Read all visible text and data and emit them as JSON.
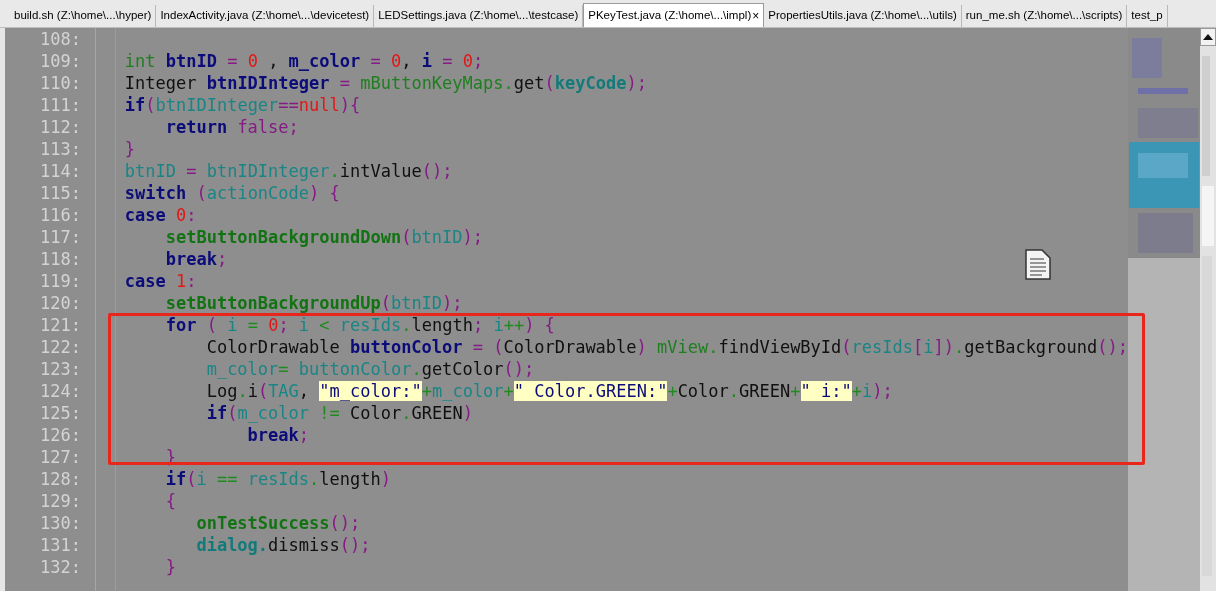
{
  "tabs": [
    {
      "label": "build.sh (Z:\\home\\...\\hyper)",
      "selected": false
    },
    {
      "label": "IndexActivity.java (Z:\\home\\...\\devicetest)",
      "selected": false
    },
    {
      "label": "LEDSettings.java (Z:\\home\\...\\testcase)",
      "selected": false
    },
    {
      "label": "PKeyTest.java (Z:\\home\\...\\impl)",
      "selected": true,
      "close": "×"
    },
    {
      "label": "PropertiesUtils.java (Z:\\home\\...\\utils)",
      "selected": false
    },
    {
      "label": "run_me.sh (Z:\\home\\...\\scripts)",
      "selected": false
    },
    {
      "label": "test_p",
      "selected": false
    }
  ],
  "editor": {
    "lines": [
      {
        "number": "108:"
      },
      {
        "number": "109:",
        "tokens": [
          {
            "kind": "type",
            "text": "int "
          },
          {
            "kind": "keyword",
            "text": "btnID"
          },
          {
            "kind": "bracket",
            "text": " = "
          },
          {
            "kind": "number",
            "text": "0"
          },
          {
            "kind": "plain",
            "text": " , "
          },
          {
            "kind": "keyword",
            "text": "m_color"
          },
          {
            "kind": "bracket",
            "text": " = "
          },
          {
            "kind": "number",
            "text": "0"
          },
          {
            "kind": "plain",
            "text": ", "
          },
          {
            "kind": "keyword",
            "text": "i"
          },
          {
            "kind": "bracket",
            "text": " = "
          },
          {
            "kind": "number",
            "text": "0"
          },
          {
            "kind": "bracket",
            "text": ";"
          }
        ]
      },
      {
        "number": "110:",
        "tokens": [
          {
            "kind": "plain",
            "text": "Integer "
          },
          {
            "kind": "keyword",
            "text": "btnIDInteger"
          },
          {
            "kind": "bracket",
            "text": " = "
          },
          {
            "kind": "type",
            "text": "mButtonKeyMaps"
          },
          {
            "kind": "operator",
            "text": "."
          },
          {
            "kind": "plain",
            "text": "get"
          },
          {
            "kind": "bracket",
            "text": "("
          },
          {
            "kind": "variable_bold",
            "text": "keyCode"
          },
          {
            "kind": "bracket",
            "text": ");"
          }
        ]
      },
      {
        "number": "111:",
        "tokens": [
          {
            "kind": "keyword",
            "text": "if"
          },
          {
            "kind": "bracket",
            "text": "("
          },
          {
            "kind": "variable",
            "text": "btnIDInteger"
          },
          {
            "kind": "bracket",
            "text": "=="
          },
          {
            "kind": "number",
            "text": "null"
          },
          {
            "kind": "bracket",
            "text": "){"
          }
        ]
      },
      {
        "number": "112:",
        "tokens": [
          {
            "kind": "keyword",
            "text": "    return"
          },
          {
            "kind": "bracket",
            "text": " false;"
          }
        ]
      },
      {
        "number": "113:",
        "tokens": [
          {
            "kind": "bracket",
            "text": "}"
          }
        ]
      },
      {
        "number": "114:",
        "tokens": [
          {
            "kind": "variable",
            "text": "btnID"
          },
          {
            "kind": "bracket",
            "text": " = "
          },
          {
            "kind": "variable",
            "text": "btnIDInteger"
          },
          {
            "kind": "operator",
            "text": "."
          },
          {
            "kind": "plain",
            "text": "intValue"
          },
          {
            "kind": "bracket",
            "text": "();"
          }
        ]
      },
      {
        "number": "115:",
        "tokens": [
          {
            "kind": "keyword",
            "text": "switch"
          },
          {
            "kind": "bracket",
            "text": " ("
          },
          {
            "kind": "variable",
            "text": "actionCode"
          },
          {
            "kind": "bracket",
            "text": ") {"
          }
        ]
      },
      {
        "number": "116:",
        "tokens": [
          {
            "kind": "keyword",
            "text": "case "
          },
          {
            "kind": "number",
            "text": "0"
          },
          {
            "kind": "bracket",
            "text": ":"
          }
        ]
      },
      {
        "number": "117:",
        "tokens": [
          {
            "kind": "method",
            "text": "    setButtonBackgroundDown"
          },
          {
            "kind": "bracket",
            "text": "("
          },
          {
            "kind": "variable",
            "text": "btnID"
          },
          {
            "kind": "bracket",
            "text": ");"
          }
        ]
      },
      {
        "number": "118:",
        "tokens": [
          {
            "kind": "keyword",
            "text": "    break"
          },
          {
            "kind": "bracket",
            "text": ";"
          }
        ]
      },
      {
        "number": "119:",
        "tokens": [
          {
            "kind": "keyword",
            "text": "case "
          },
          {
            "kind": "number",
            "text": "1"
          },
          {
            "kind": "bracket",
            "text": ":"
          }
        ]
      },
      {
        "number": "120:",
        "tokens": [
          {
            "kind": "method",
            "text": "    setButtonBackgroundUp"
          },
          {
            "kind": "bracket",
            "text": "("
          },
          {
            "kind": "variable",
            "text": "btnID"
          },
          {
            "kind": "bracket",
            "text": ");"
          }
        ]
      },
      {
        "number": "121:",
        "tokens": [
          {
            "kind": "keyword",
            "text": "    for"
          },
          {
            "kind": "bracket",
            "text": " ( "
          },
          {
            "kind": "variable",
            "text": "i"
          },
          {
            "kind": "operator",
            "text": " = "
          },
          {
            "kind": "number",
            "text": "0"
          },
          {
            "kind": "bracket",
            "text": "; "
          },
          {
            "kind": "variable",
            "text": "i"
          },
          {
            "kind": "operator",
            "text": " < "
          },
          {
            "kind": "variable",
            "text": "resIds"
          },
          {
            "kind": "operator",
            "text": "."
          },
          {
            "kind": "plain",
            "text": "length"
          },
          {
            "kind": "bracket",
            "text": "; "
          },
          {
            "kind": "variable",
            "text": "i"
          },
          {
            "kind": "operator",
            "text": "++"
          },
          {
            "kind": "bracket",
            "text": ") {"
          }
        ]
      },
      {
        "number": "122:",
        "tokens": [
          {
            "kind": "plain",
            "text": "        ColorDrawable "
          },
          {
            "kind": "keyword",
            "text": "buttonColor"
          },
          {
            "kind": "bracket",
            "text": " = ("
          },
          {
            "kind": "plain",
            "text": "ColorDrawable"
          },
          {
            "kind": "bracket",
            "text": ") "
          },
          {
            "kind": "type",
            "text": "mView"
          },
          {
            "kind": "operator",
            "text": "."
          },
          {
            "kind": "plain",
            "text": "findViewById"
          },
          {
            "kind": "bracket",
            "text": "("
          },
          {
            "kind": "variable",
            "text": "resIds"
          },
          {
            "kind": "bracket",
            "text": "["
          },
          {
            "kind": "variable",
            "text": "i"
          },
          {
            "kind": "bracket",
            "text": "])"
          },
          {
            "kind": "operator",
            "text": "."
          },
          {
            "kind": "plain",
            "text": "getBackground"
          },
          {
            "kind": "bracket",
            "text": "();"
          }
        ]
      },
      {
        "number": "123:",
        "tokens": [
          {
            "kind": "variable",
            "text": "        m_color"
          },
          {
            "kind": "operator",
            "text": "= "
          },
          {
            "kind": "variable",
            "text": "buttonColor"
          },
          {
            "kind": "operator",
            "text": "."
          },
          {
            "kind": "plain",
            "text": "getColor"
          },
          {
            "kind": "bracket",
            "text": "();"
          }
        ]
      },
      {
        "number": "124:",
        "tokens": [
          {
            "kind": "plain",
            "text": "        Log"
          },
          {
            "kind": "operator",
            "text": "."
          },
          {
            "kind": "plain",
            "text": "i"
          },
          {
            "kind": "bracket",
            "text": "("
          },
          {
            "kind": "variable",
            "text": "TAG"
          },
          {
            "kind": "plain",
            "text": ", "
          },
          {
            "kind": "string",
            "text": "\"m_color:\""
          },
          {
            "kind": "operator",
            "text": "+"
          },
          {
            "kind": "variable",
            "text": "m_color"
          },
          {
            "kind": "operator",
            "text": "+"
          },
          {
            "kind": "string",
            "text": "\" Color.GREEN:\""
          },
          {
            "kind": "operator",
            "text": "+"
          },
          {
            "kind": "plain",
            "text": "Color"
          },
          {
            "kind": "operator",
            "text": "."
          },
          {
            "kind": "plain",
            "text": "GREEN"
          },
          {
            "kind": "operator",
            "text": "+"
          },
          {
            "kind": "string",
            "text": "\" i:\""
          },
          {
            "kind": "operator",
            "text": "+"
          },
          {
            "kind": "variable",
            "text": "i"
          },
          {
            "kind": "bracket",
            "text": ");"
          }
        ]
      },
      {
        "number": "125:",
        "tokens": [
          {
            "kind": "keyword",
            "text": "        if"
          },
          {
            "kind": "bracket",
            "text": "("
          },
          {
            "kind": "variable",
            "text": "m_color"
          },
          {
            "kind": "operator",
            "text": " != "
          },
          {
            "kind": "plain",
            "text": "Color"
          },
          {
            "kind": "operator",
            "text": "."
          },
          {
            "kind": "plain",
            "text": "GREEN"
          },
          {
            "kind": "bracket",
            "text": ")"
          }
        ]
      },
      {
        "number": "126:",
        "tokens": [
          {
            "kind": "keyword",
            "text": "            break"
          },
          {
            "kind": "bracket",
            "text": ";"
          }
        ]
      },
      {
        "number": "127:",
        "tokens": [
          {
            "kind": "bracket",
            "text": "    }"
          }
        ]
      },
      {
        "number": "128:",
        "tokens": [
          {
            "kind": "keyword",
            "text": "    if"
          },
          {
            "kind": "bracket",
            "text": "("
          },
          {
            "kind": "variable",
            "text": "i"
          },
          {
            "kind": "operator",
            "text": " == "
          },
          {
            "kind": "variable",
            "text": "resIds"
          },
          {
            "kind": "operator",
            "text": "."
          },
          {
            "kind": "plain",
            "text": "length"
          },
          {
            "kind": "bracket",
            "text": ")"
          }
        ]
      },
      {
        "number": "129:",
        "tokens": [
          {
            "kind": "bracket",
            "text": "    {"
          }
        ]
      },
      {
        "number": "130:",
        "tokens": [
          {
            "kind": "method",
            "text": "       onTestSuccess"
          },
          {
            "kind": "bracket",
            "text": "();"
          }
        ]
      },
      {
        "number": "131:",
        "tokens": [
          {
            "kind": "variable_bold",
            "text": "       dialog."
          },
          {
            "kind": "plain",
            "text": "dismiss"
          },
          {
            "kind": "bracket",
            "text": "();"
          }
        ]
      },
      {
        "number": "132:",
        "tokens": [
          {
            "kind": "bracket",
            "text": "    }"
          }
        ]
      }
    ]
  }
}
